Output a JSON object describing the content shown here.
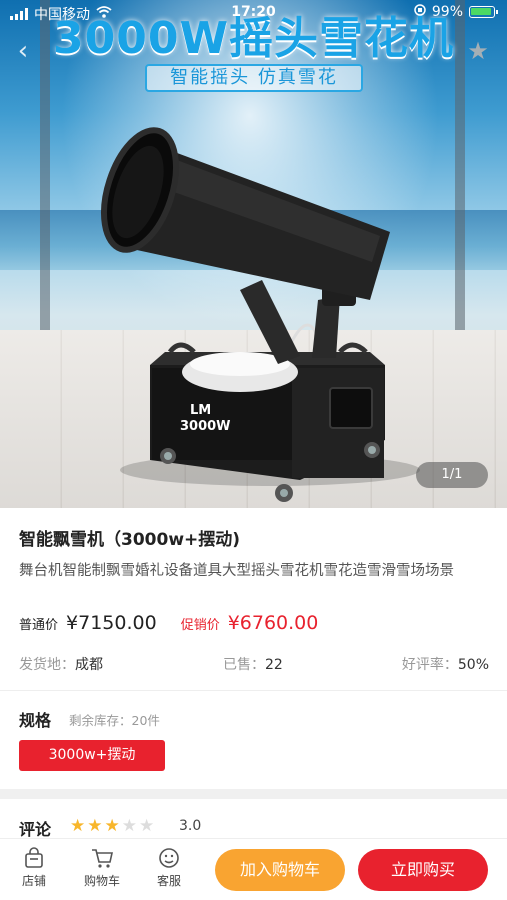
{
  "status_bar": {
    "carrier": "中国移动",
    "time": "17:20",
    "battery": "99%"
  },
  "hero": {
    "banner_title": "3000W摇头雪花机",
    "banner_subtitle": "智能摇头 仿真雪花",
    "machine_label_line1": "LM",
    "machine_label_line2": "3000W",
    "image_counter": "1/1"
  },
  "product": {
    "title": "智能飘雪机（3000w+摆动)",
    "description": "舞台机智能制飘雪婚礼设备道具大型摇头雪花机雪花造雪滑雪场场景",
    "normal_price_label": "普通价",
    "normal_price": "¥7150.00",
    "promo_price_label": "促销价",
    "promo_price": "¥6760.00",
    "origin_label": "发货地：",
    "origin_value": "成都",
    "sold_label": "已售：",
    "sold_value": "22",
    "rating_label": "好评率：",
    "rating_value": "50%"
  },
  "spec": {
    "heading": "规格",
    "stock_label": "剩余库存：",
    "stock_value": "20件",
    "selected_option": "3000w+摆动"
  },
  "reviews": {
    "heading": "评论",
    "score": "3.0",
    "stars_filled": 3,
    "stars_total": 5
  },
  "bottom_bar": {
    "shop_label": "店铺",
    "cart_label": "购物车",
    "service_label": "客服",
    "add_to_cart_label": "加入购物车",
    "buy_now_label": "立即购买"
  },
  "colors": {
    "accent_red": "#e8222e",
    "accent_orange": "#f9a431",
    "star_yellow": "#f8b62b"
  }
}
